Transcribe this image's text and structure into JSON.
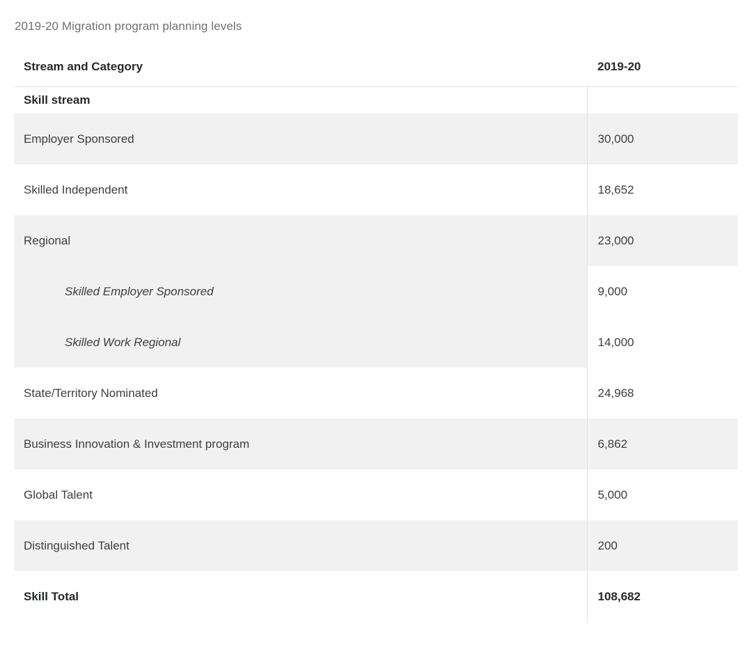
{
  "table": {
    "caption": "2019-20 Migration program planning levels",
    "columns": [
      {
        "key": "label",
        "header": "Stream and Category"
      },
      {
        "key": "value",
        "header": "2019-20"
      }
    ],
    "rows": [
      {
        "type": "group",
        "label": "Skill stream",
        "value": ""
      },
      {
        "type": "data",
        "shade": true,
        "label": "Employer Sponsored",
        "value": "30,000"
      },
      {
        "type": "data",
        "shade": false,
        "label": "Skilled Independent",
        "value": "18,652"
      },
      {
        "type": "data",
        "shade": true,
        "label": "Regional",
        "value": "23,000"
      },
      {
        "type": "sub",
        "shade": true,
        "label": "Skilled Employer Sponsored",
        "value": "9,000"
      },
      {
        "type": "sub",
        "shade": true,
        "label": "Skilled Work Regional",
        "value": "14,000"
      },
      {
        "type": "data",
        "shade": false,
        "label": "State/Territory Nominated",
        "value": "24,968"
      },
      {
        "type": "data",
        "shade": true,
        "label": "Business Innovation & Investment program",
        "value": "6,862"
      },
      {
        "type": "data",
        "shade": false,
        "label": "Global Talent",
        "value": "5,000"
      },
      {
        "type": "data",
        "shade": true,
        "label": "Distinguished Talent",
        "value": "200"
      },
      {
        "type": "total",
        "shade": false,
        "label": "Skill Total",
        "value": "108,682"
      }
    ]
  },
  "colors": {
    "page_background": "#ffffff",
    "row_shade": "#f1f1f1",
    "caption_text": "#6f6f6f",
    "body_text": "#3b3e41",
    "heading_text": "#26292c",
    "rule": "#e2e2e2",
    "column_divider": "#e4e4e4"
  },
  "chart_data": {
    "type": "table",
    "title": "2019-20 Migration program planning levels",
    "columns": [
      "Stream and Category",
      "2019-20"
    ],
    "categories": [
      "Employer Sponsored",
      "Skilled Independent",
      "Regional",
      "Skilled Employer Sponsored",
      "Skilled Work Regional",
      "State/Territory Nominated",
      "Business Innovation & Investment program",
      "Global Talent",
      "Distinguished Talent",
      "Skill Total"
    ],
    "values": [
      30000,
      18652,
      23000,
      9000,
      14000,
      24968,
      6862,
      5000,
      200,
      108682
    ],
    "value_labels": [
      "30,000",
      "18,652",
      "23,000",
      "9,000",
      "14,000",
      "24,968",
      "6,862",
      "5,000",
      "200",
      "108,682"
    ],
    "group": "Skill stream",
    "subitems": [
      "Skilled Employer Sponsored",
      "Skilled Work Regional"
    ],
    "total_row": {
      "label": "Skill Total",
      "value": 108682,
      "value_label": "108,682"
    },
    "xlabel": "Stream and Category",
    "ylabel": "2019-20"
  }
}
